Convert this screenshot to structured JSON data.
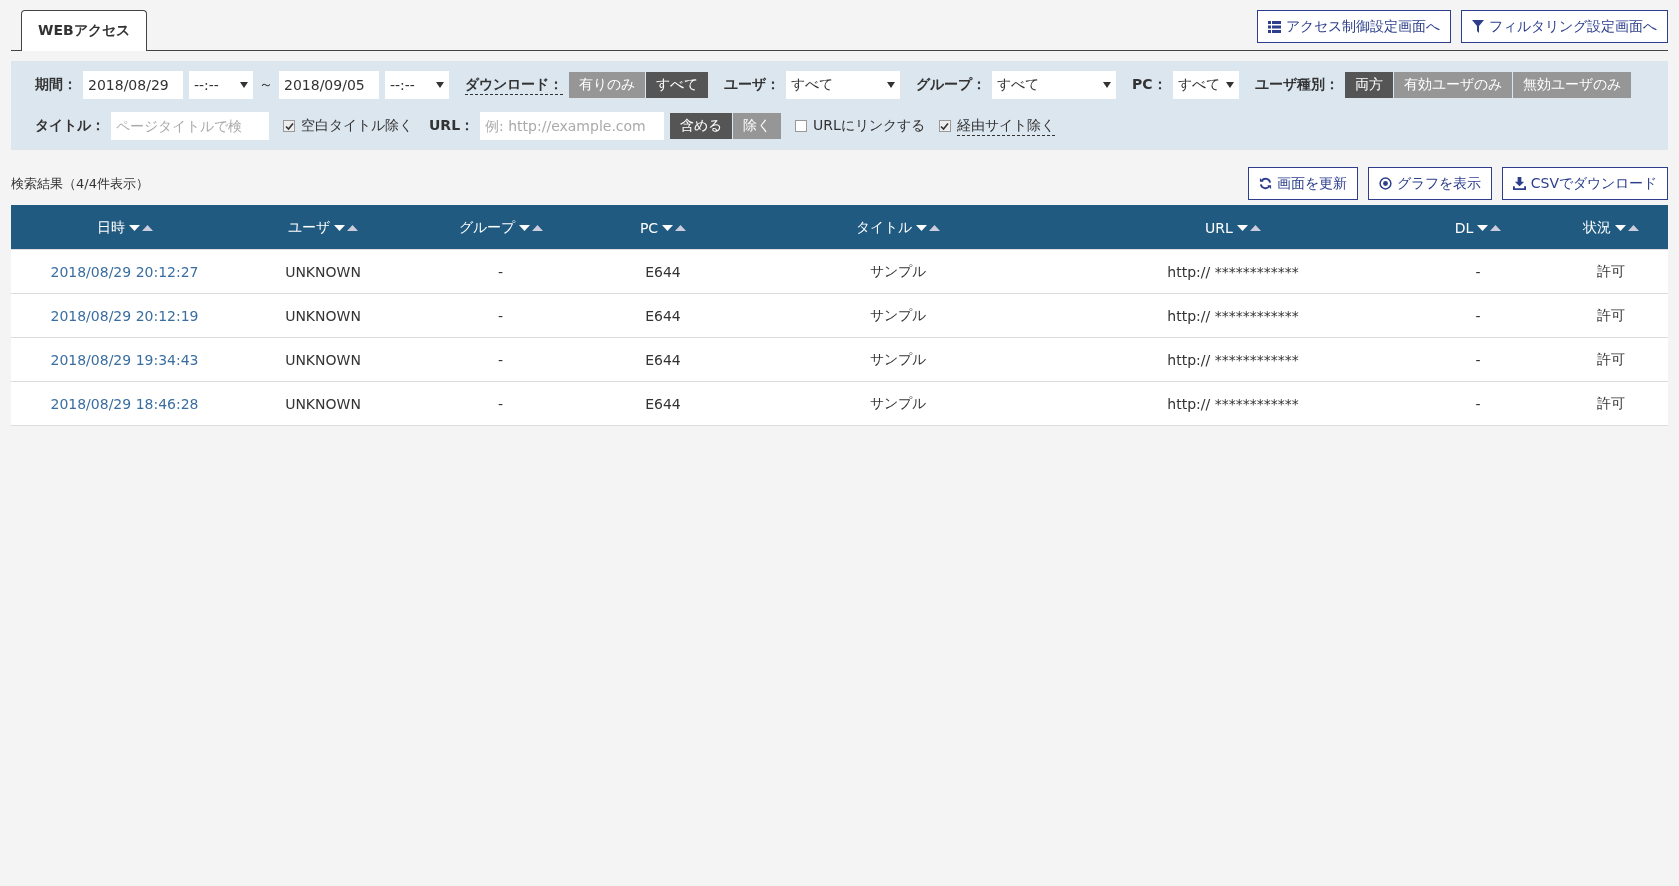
{
  "tabs": [
    {
      "label": "WEBアクセス",
      "selected": true
    }
  ],
  "nav_buttons": [
    {
      "label": "アクセス制御設定画面へ",
      "kind": "list"
    },
    {
      "label": "フィルタリング設定画面へ",
      "kind": "filter"
    }
  ],
  "filters": {
    "period": {
      "label": "期間：",
      "from": "2018/08/29",
      "from_time": "--:--",
      "separator": "～",
      "to": "2018/09/05",
      "to_time": "--:--"
    },
    "download": {
      "label": "ダウンロード：",
      "options": [
        {
          "label": "有りのみ",
          "selected": false
        },
        {
          "label": "すべて",
          "selected": true
        }
      ]
    },
    "user": {
      "label": "ユーザ：",
      "value": "すべて"
    },
    "group": {
      "label": "グループ：",
      "value": "すべて"
    },
    "pc": {
      "label": "PC：",
      "value": "すべて"
    },
    "user_type": {
      "label": "ユーザ種別：",
      "options": [
        {
          "label": "両方",
          "selected": true
        },
        {
          "label": "有効ユーザのみ",
          "selected": false
        },
        {
          "label": "無効ユーザのみ",
          "selected": false
        }
      ]
    },
    "title": {
      "label": "タイトル：",
      "placeholder": "ページタイトルで検",
      "exclude_blank": {
        "label": "空白タイトル除く",
        "checked": true
      }
    },
    "url": {
      "label": "URL：",
      "placeholder": "例: http://example.com",
      "options": [
        {
          "label": "含める",
          "selected": true
        },
        {
          "label": "除く",
          "selected": false
        }
      ]
    },
    "link_url": {
      "label": "URLにリンクする",
      "checked": false
    },
    "exclude_via": {
      "label": "経由サイト除く",
      "checked": true
    }
  },
  "result_summary": "検索結果（4/4件表示）",
  "actions": [
    {
      "label": "画面を更新",
      "kind": "refresh"
    },
    {
      "label": "グラフを表示",
      "kind": "graph"
    },
    {
      "label": "CSVでダウンロード",
      "kind": "download"
    }
  ],
  "table": {
    "columns": [
      "日時",
      "ユーザ",
      "グループ",
      "PC",
      "タイトル",
      "URL",
      "DL",
      "状況"
    ],
    "rows": [
      [
        "2018/08/29 20:12:27",
        "UNKNOWN",
        "-",
        "E644",
        "サンプル",
        "http:// ************",
        "-",
        "許可"
      ],
      [
        "2018/08/29 20:12:19",
        "UNKNOWN",
        "-",
        "E644",
        "サンプル",
        "http:// ************",
        "-",
        "許可"
      ],
      [
        "2018/08/29 19:34:43",
        "UNKNOWN",
        "-",
        "E644",
        "サンプル",
        "http:// ************",
        "-",
        "許可"
      ],
      [
        "2018/08/29 18:46:28",
        "UNKNOWN",
        "-",
        "E644",
        "サンプル",
        "http:// ************",
        "-",
        "許可"
      ]
    ]
  }
}
